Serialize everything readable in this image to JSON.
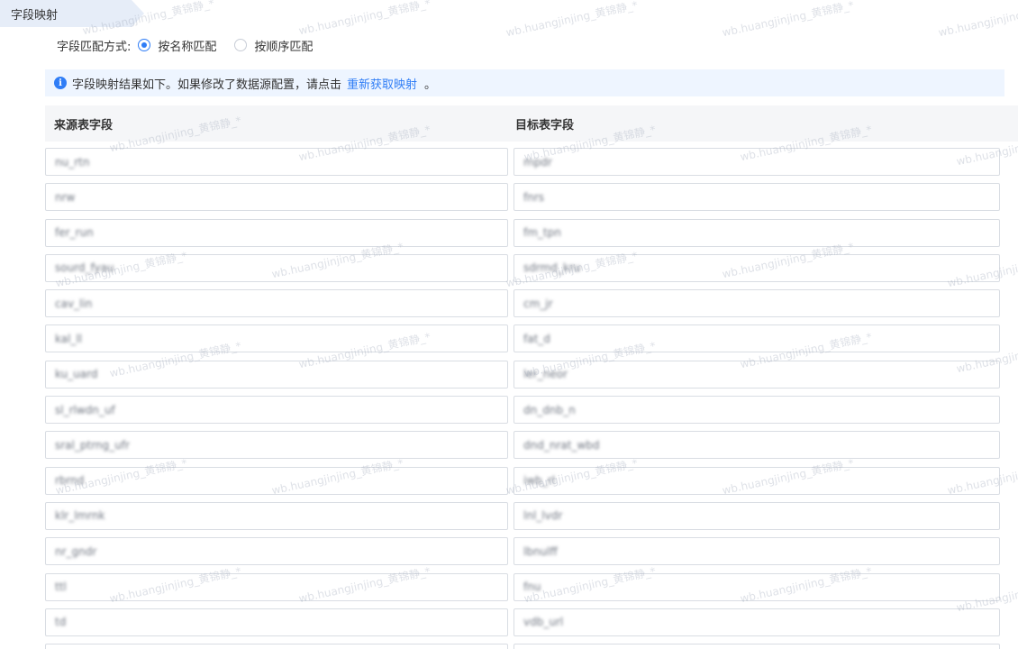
{
  "section": {
    "title": "字段映射"
  },
  "match_mode": {
    "label": "字段匹配方式:",
    "options": [
      {
        "label": "按名称匹配",
        "checked": true
      },
      {
        "label": "按顺序匹配",
        "checked": false
      }
    ]
  },
  "info": {
    "text": "字段映射结果如下。如果修改了数据源配置，请点击",
    "link": "重新获取映射",
    "suffix": "。"
  },
  "table": {
    "source_header": "来源表字段",
    "target_header": "目标表字段",
    "rows": [
      {
        "source": "nu_rtn",
        "target": "mpdr"
      },
      {
        "source": "nrw",
        "target": "fnrs"
      },
      {
        "source": "fer_run",
        "target": "fm_tpn"
      },
      {
        "source": "sourd_fyau",
        "target": "sdrmd_kru"
      },
      {
        "source": "cav_lin",
        "target": "cm_jr"
      },
      {
        "source": "kal_ll",
        "target": "fat_d"
      },
      {
        "source": "ku_uard",
        "target": "ler_neor"
      },
      {
        "source": "sl_rlwdn_uf",
        "target": "dn_dnb_n"
      },
      {
        "source": "sral_ptrng_ufr",
        "target": "dnd_nrat_wbd"
      },
      {
        "source": "rbrnd",
        "target": "iwb_rl"
      },
      {
        "source": "klr_lmrnk",
        "target": "lnl_lvdr"
      },
      {
        "source": "nr_gndr",
        "target": "lbnulff"
      },
      {
        "source": "ttl",
        "target": "fnu"
      },
      {
        "source": "td",
        "target": "vdb_url"
      },
      {
        "source": "",
        "target": ""
      }
    ]
  },
  "watermark": {
    "text": "wb.huangjinjing_黄锦静_*"
  },
  "colors": {
    "accent": "#2f7df6",
    "tab_bg": "#e6edf8",
    "info_bg": "#eef5ff",
    "header_bg": "#f5f6f8"
  }
}
